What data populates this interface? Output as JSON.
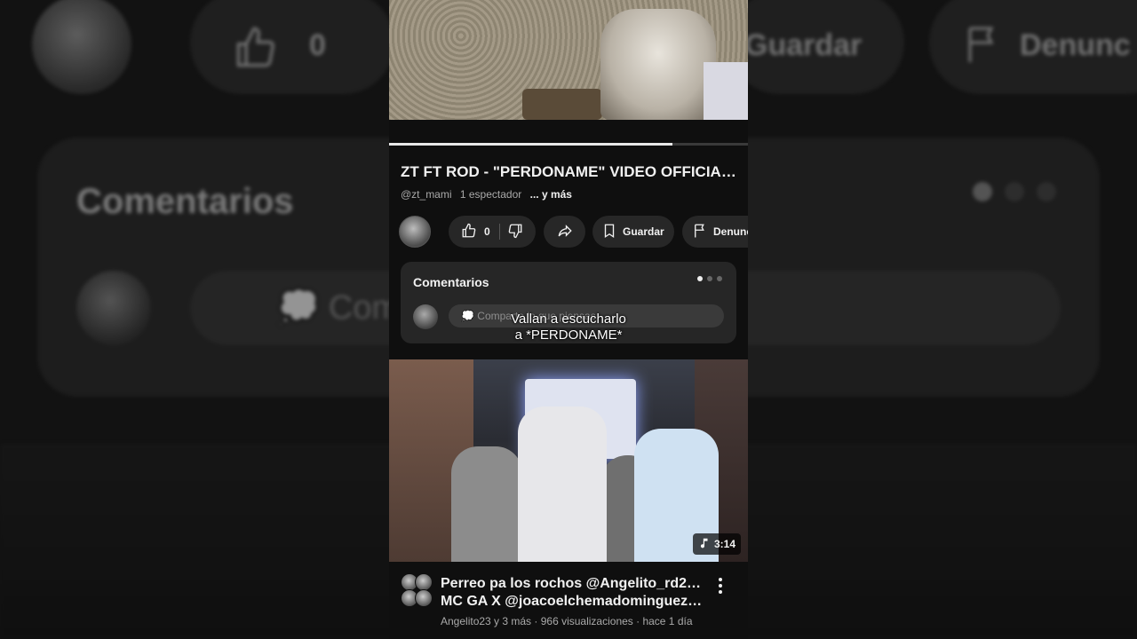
{
  "background": {
    "like_count": "0",
    "save_label": "Guardar",
    "report_label": "Denunc",
    "comments_label": "Comentarios",
    "comment_prompt": "Compa"
  },
  "video": {
    "title": "ZT FT ROD - \"PERDONAME\" VIDEO OFFICIAL ...",
    "channel": "@zt_mami",
    "viewers": "1 espectador",
    "more": "... y más",
    "progress": 0.79
  },
  "actions": {
    "like_count": "0",
    "save_label": "Guardar",
    "report_label": "Denunc"
  },
  "comments": {
    "title": "Comentarios",
    "placeholder": "Comparte lo que piensas",
    "page_dots": 3,
    "active_dot": 0
  },
  "caption": {
    "line1": "Vallan a escucharlo",
    "line2": "a *PERDONAME*"
  },
  "recommended": {
    "duration": "3:14",
    "title_line1": "Perreo pa los rochos @Angelito_rd23 X",
    "title_line2": "MC GA X @joacoelchemadominguez1...",
    "meta": "Angelito23 y 3 más · 966 visualizaciones · hace 1 día"
  },
  "icons": {
    "like": "thumb-up-icon",
    "dislike": "thumb-down-icon",
    "share": "share-icon",
    "save": "bookmark-icon",
    "report": "flag-icon",
    "music": "music-note-icon",
    "more": "more-vert-icon"
  }
}
